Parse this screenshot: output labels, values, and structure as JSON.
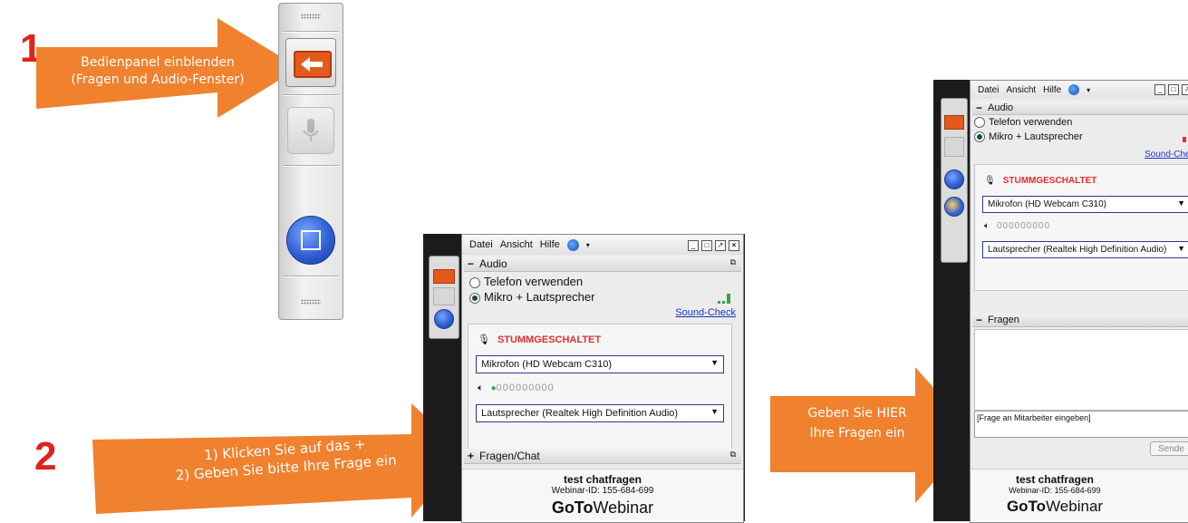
{
  "step1": {
    "number": "1",
    "arrow_line1": "Bedienpanel einblenden",
    "arrow_line2": "(Fragen und Audio-Fenster)"
  },
  "step2": {
    "number": "2",
    "arrow_line1": "1)  Klicken Sie auf das +",
    "arrow_line2": "2)  Geben Sie bitte Ihre Frage ein"
  },
  "step3": {
    "arrow_line1": "Geben Sie HIER",
    "arrow_line2": "Ihre Fragen ein"
  },
  "colors": {
    "arrow": "#f0812e",
    "accent_red": "#e0231b",
    "muted_red": "#e03030",
    "link_blue": "#1a33c8",
    "level_green": "#2fa84a"
  },
  "panel_a": {
    "menu": {
      "file": "Datei",
      "view": "Ansicht",
      "help": "Hilfe"
    },
    "audio": {
      "header": "Audio",
      "phone_option": "Telefon verwenden",
      "mic_option": "Mikro + Lautsprecher",
      "sound_check": "Sound-Check",
      "status": "STUMMGESCHALTET",
      "microphone": "Mikrofon (HD Webcam C310)",
      "speaker": "Lautsprecher (Realtek High Definition Audio)",
      "level_dots": "000000000"
    },
    "questions_header": "Fragen/Chat",
    "webinar_title": "test chatfragen",
    "webinar_id": "Webinar-ID: 155-684-699",
    "brand_bold": "GoTo",
    "brand_regular": "Webinar"
  },
  "panel_b": {
    "menu": {
      "file": "Datei",
      "view": "Ansicht",
      "help": "Hilfe"
    },
    "audio": {
      "header": "Audio",
      "phone_option": "Telefon verwenden",
      "mic_option": "Mikro + Lautsprecher",
      "sound_check": "Sound-Che",
      "status": "STUMMGESCHALTET",
      "microphone": "Mikrofon (HD Webcam C310)",
      "speaker": "Lautsprecher (Realtek High Definition Audio)",
      "level_dots": "000000000"
    },
    "questions_header": "Fragen",
    "question_placeholder": "[Frage an Mitarbeiter eingeben]",
    "send_button": "Sende",
    "webinar_title": "test chatfragen",
    "webinar_id": "Webinar-ID: 155-684-699",
    "brand_bold": "GoTo",
    "brand_regular": "Webinar"
  }
}
